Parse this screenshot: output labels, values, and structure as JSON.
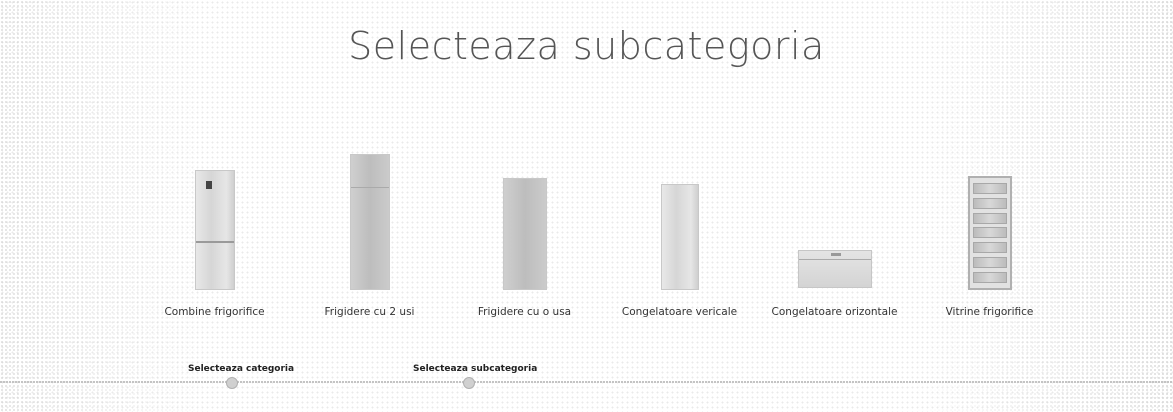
{
  "page": {
    "title": "Selecteaza subcategoria"
  },
  "subcategories": [
    {
      "label": "Combine frigorifice",
      "icon": "combi-fridge-image"
    },
    {
      "label": "Frigidere cu 2 usi",
      "icon": "two-door-fridge-image"
    },
    {
      "label": "Frigidere cu o usa",
      "icon": "one-door-fridge-image"
    },
    {
      "label": "Congelatoare vericale",
      "icon": "upright-freezer-image"
    },
    {
      "label": "Congelatoare orizontale",
      "icon": "chest-freezer-image"
    },
    {
      "label": "Vitrine frigorifice",
      "icon": "display-fridge-image"
    }
  ],
  "stepper": {
    "steps": [
      {
        "label": "Selecteaza categoria",
        "state": "completed"
      },
      {
        "label": "Selecteaza subcategoria",
        "state": "current"
      },
      {
        "label": "",
        "state": "upcoming"
      },
      {
        "label": "",
        "state": "upcoming"
      }
    ]
  }
}
